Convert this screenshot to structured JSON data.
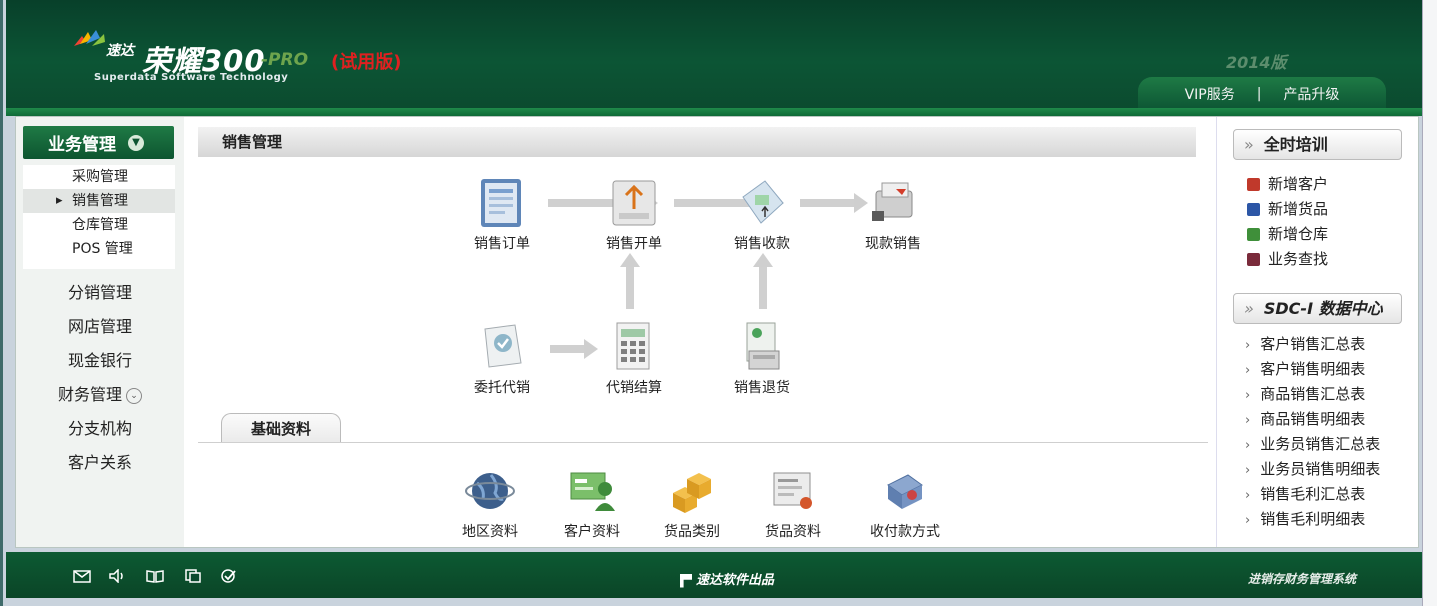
{
  "header": {
    "logo_small": "速达",
    "logo_big": "荣耀300",
    "logo_pro": "-PRO",
    "logo_trial": "(试用版)",
    "logo_sub": "Superdata Software Technology",
    "version": "2014版",
    "vip_label": "VIP服务",
    "upgrade_label": "产品升级",
    "separator": "|"
  },
  "sidebar": {
    "title": "业务管理",
    "sub_items": [
      {
        "label": "采购管理"
      },
      {
        "label": "销售管理",
        "active": true
      },
      {
        "label": "仓库管理"
      },
      {
        "label": "POS 管理"
      }
    ],
    "items": [
      {
        "label": "分销管理"
      },
      {
        "label": "网店管理"
      },
      {
        "label": "现金银行"
      },
      {
        "label": "财务管理"
      },
      {
        "label": "分支机构"
      },
      {
        "label": "客户关系"
      }
    ]
  },
  "main": {
    "title": "销售管理",
    "flow": [
      {
        "label": "销售订单",
        "icon": "sales-order-icon"
      },
      {
        "label": "销售开单",
        "icon": "sales-invoice-icon"
      },
      {
        "label": "销售收款",
        "icon": "sales-receipt-icon"
      },
      {
        "label": "现款销售",
        "icon": "cash-sale-icon"
      },
      {
        "label": "委托代销",
        "icon": "consignment-icon"
      },
      {
        "label": "代销结算",
        "icon": "calculator-icon"
      },
      {
        "label": "销售退货",
        "icon": "sales-return-icon"
      }
    ],
    "basic_tab": "基础资料",
    "basic_items": [
      {
        "label": "地区资料",
        "icon": "globe-icon"
      },
      {
        "label": "客户资料",
        "icon": "customer-card-icon"
      },
      {
        "label": "货品类别",
        "icon": "boxes-icon"
      },
      {
        "label": "货品资料",
        "icon": "goods-info-icon"
      },
      {
        "label": "收付款方式",
        "icon": "payment-method-icon"
      }
    ]
  },
  "right_panel": {
    "training_title": "全时培训",
    "quick_items": [
      {
        "label": "新增客户",
        "color": "#c0392b"
      },
      {
        "label": "新增货品",
        "color": "#2c56a6"
      },
      {
        "label": "新增仓库",
        "color": "#3f8f3a"
      },
      {
        "label": "业务查找",
        "color": "#7a2b3b"
      }
    ],
    "data_center_title": "SDC-I 数据中心",
    "reports": [
      {
        "label": "客户销售汇总表"
      },
      {
        "label": "客户销售明细表"
      },
      {
        "label": "商品销售汇总表"
      },
      {
        "label": "商品销售明细表"
      },
      {
        "label": "业务员销售汇总表"
      },
      {
        "label": "业务员销售明细表"
      },
      {
        "label": "销售毛利汇总表"
      },
      {
        "label": "销售毛利明细表"
      }
    ]
  },
  "footer": {
    "center": "速达软件出品",
    "right": "进销存财务管理系统",
    "icons": [
      "mail-icon",
      "speaker-icon",
      "book-icon",
      "copy-icon",
      "check-circle-icon"
    ]
  },
  "colors": {
    "brand_green": "#0c5535",
    "accent_red": "#e02020"
  }
}
